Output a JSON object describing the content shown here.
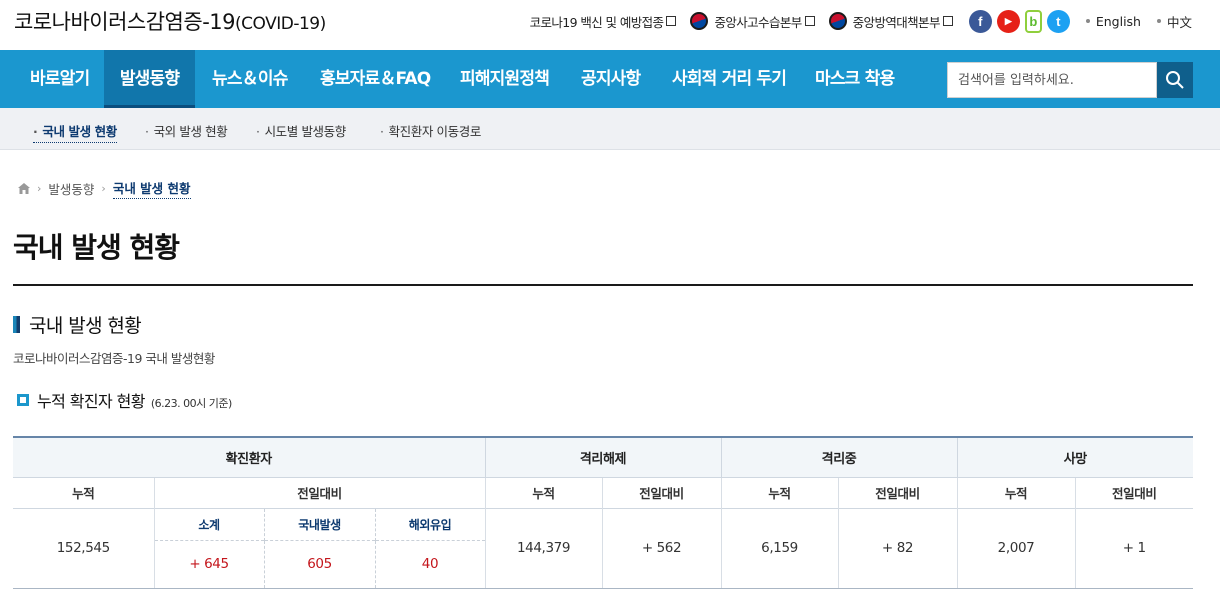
{
  "header": {
    "site_title": "코로나바이러스감염증-19",
    "site_title_sub": "(COVID-19)",
    "links": [
      {
        "label": "코로나19 백신 및 예방접종",
        "icon": "external-link-icon"
      },
      {
        "label": "중앙사고수습본부",
        "icon": "taegeuk-emblem-icon"
      },
      {
        "label": "중앙방역대책본부",
        "icon": "taegeuk-emblem-icon"
      }
    ],
    "social": [
      {
        "name": "facebook",
        "glyph": "f",
        "icon": "facebook-icon"
      },
      {
        "name": "youtube",
        "glyph": "▶",
        "icon": "youtube-icon"
      },
      {
        "name": "naver-blog",
        "glyph": "b",
        "icon": "naver-blog-icon"
      },
      {
        "name": "twitter",
        "glyph": "t",
        "icon": "twitter-icon"
      }
    ],
    "languages": [
      "English",
      "中文"
    ]
  },
  "gnb": {
    "items": [
      "바로알기",
      "발생동향",
      "뉴스＆이슈",
      "홍보자료＆FAQ",
      "피해지원정책",
      "공지사항",
      "사회적 거리 두기",
      "마스크 착용"
    ],
    "active_index": 1,
    "search_placeholder": "검색어를 입력하세요.",
    "colors": {
      "bar": "#1b97cf",
      "active": "#1176ab",
      "search_button": "#0f5f8c"
    }
  },
  "lnb": {
    "items": [
      "국내 발생 현황",
      "국외 발생 현황",
      "시도별 발생동향",
      "확진환자 이동경로"
    ],
    "active_index": 0
  },
  "breadcrumb": {
    "home_icon": "home-icon",
    "items": [
      "발생동향",
      "국내 발생 현황"
    ]
  },
  "page": {
    "title": "국내 발생 현황",
    "section_title": "국내 발생 현황",
    "section_desc": "코로나바이러스감염증-19 국내 발생현황",
    "subsection_title": "누적 확진자 현황",
    "subsection_note": "(6.23. 00시 기준)"
  },
  "table": {
    "groups": [
      "확진환자",
      "격리해제",
      "격리중",
      "사망"
    ],
    "col_cumulative": "누적",
    "col_change": "전일대비",
    "confirmed_breakdown_labels": [
      "소계",
      "국내발생",
      "해외유입"
    ],
    "confirmed": {
      "cumulative": "152,545",
      "subtotal": "+ 645",
      "domestic": "605",
      "imported": "40"
    },
    "released": {
      "cumulative": "144,379",
      "change": "+ 562"
    },
    "isolated": {
      "cumulative": "6,159",
      "change": "+ 82"
    },
    "deceased": {
      "cumulative": "2,007",
      "change": "+ 1"
    },
    "colors": {
      "increase": "#c4161c",
      "header_border": "#6685a8"
    }
  }
}
